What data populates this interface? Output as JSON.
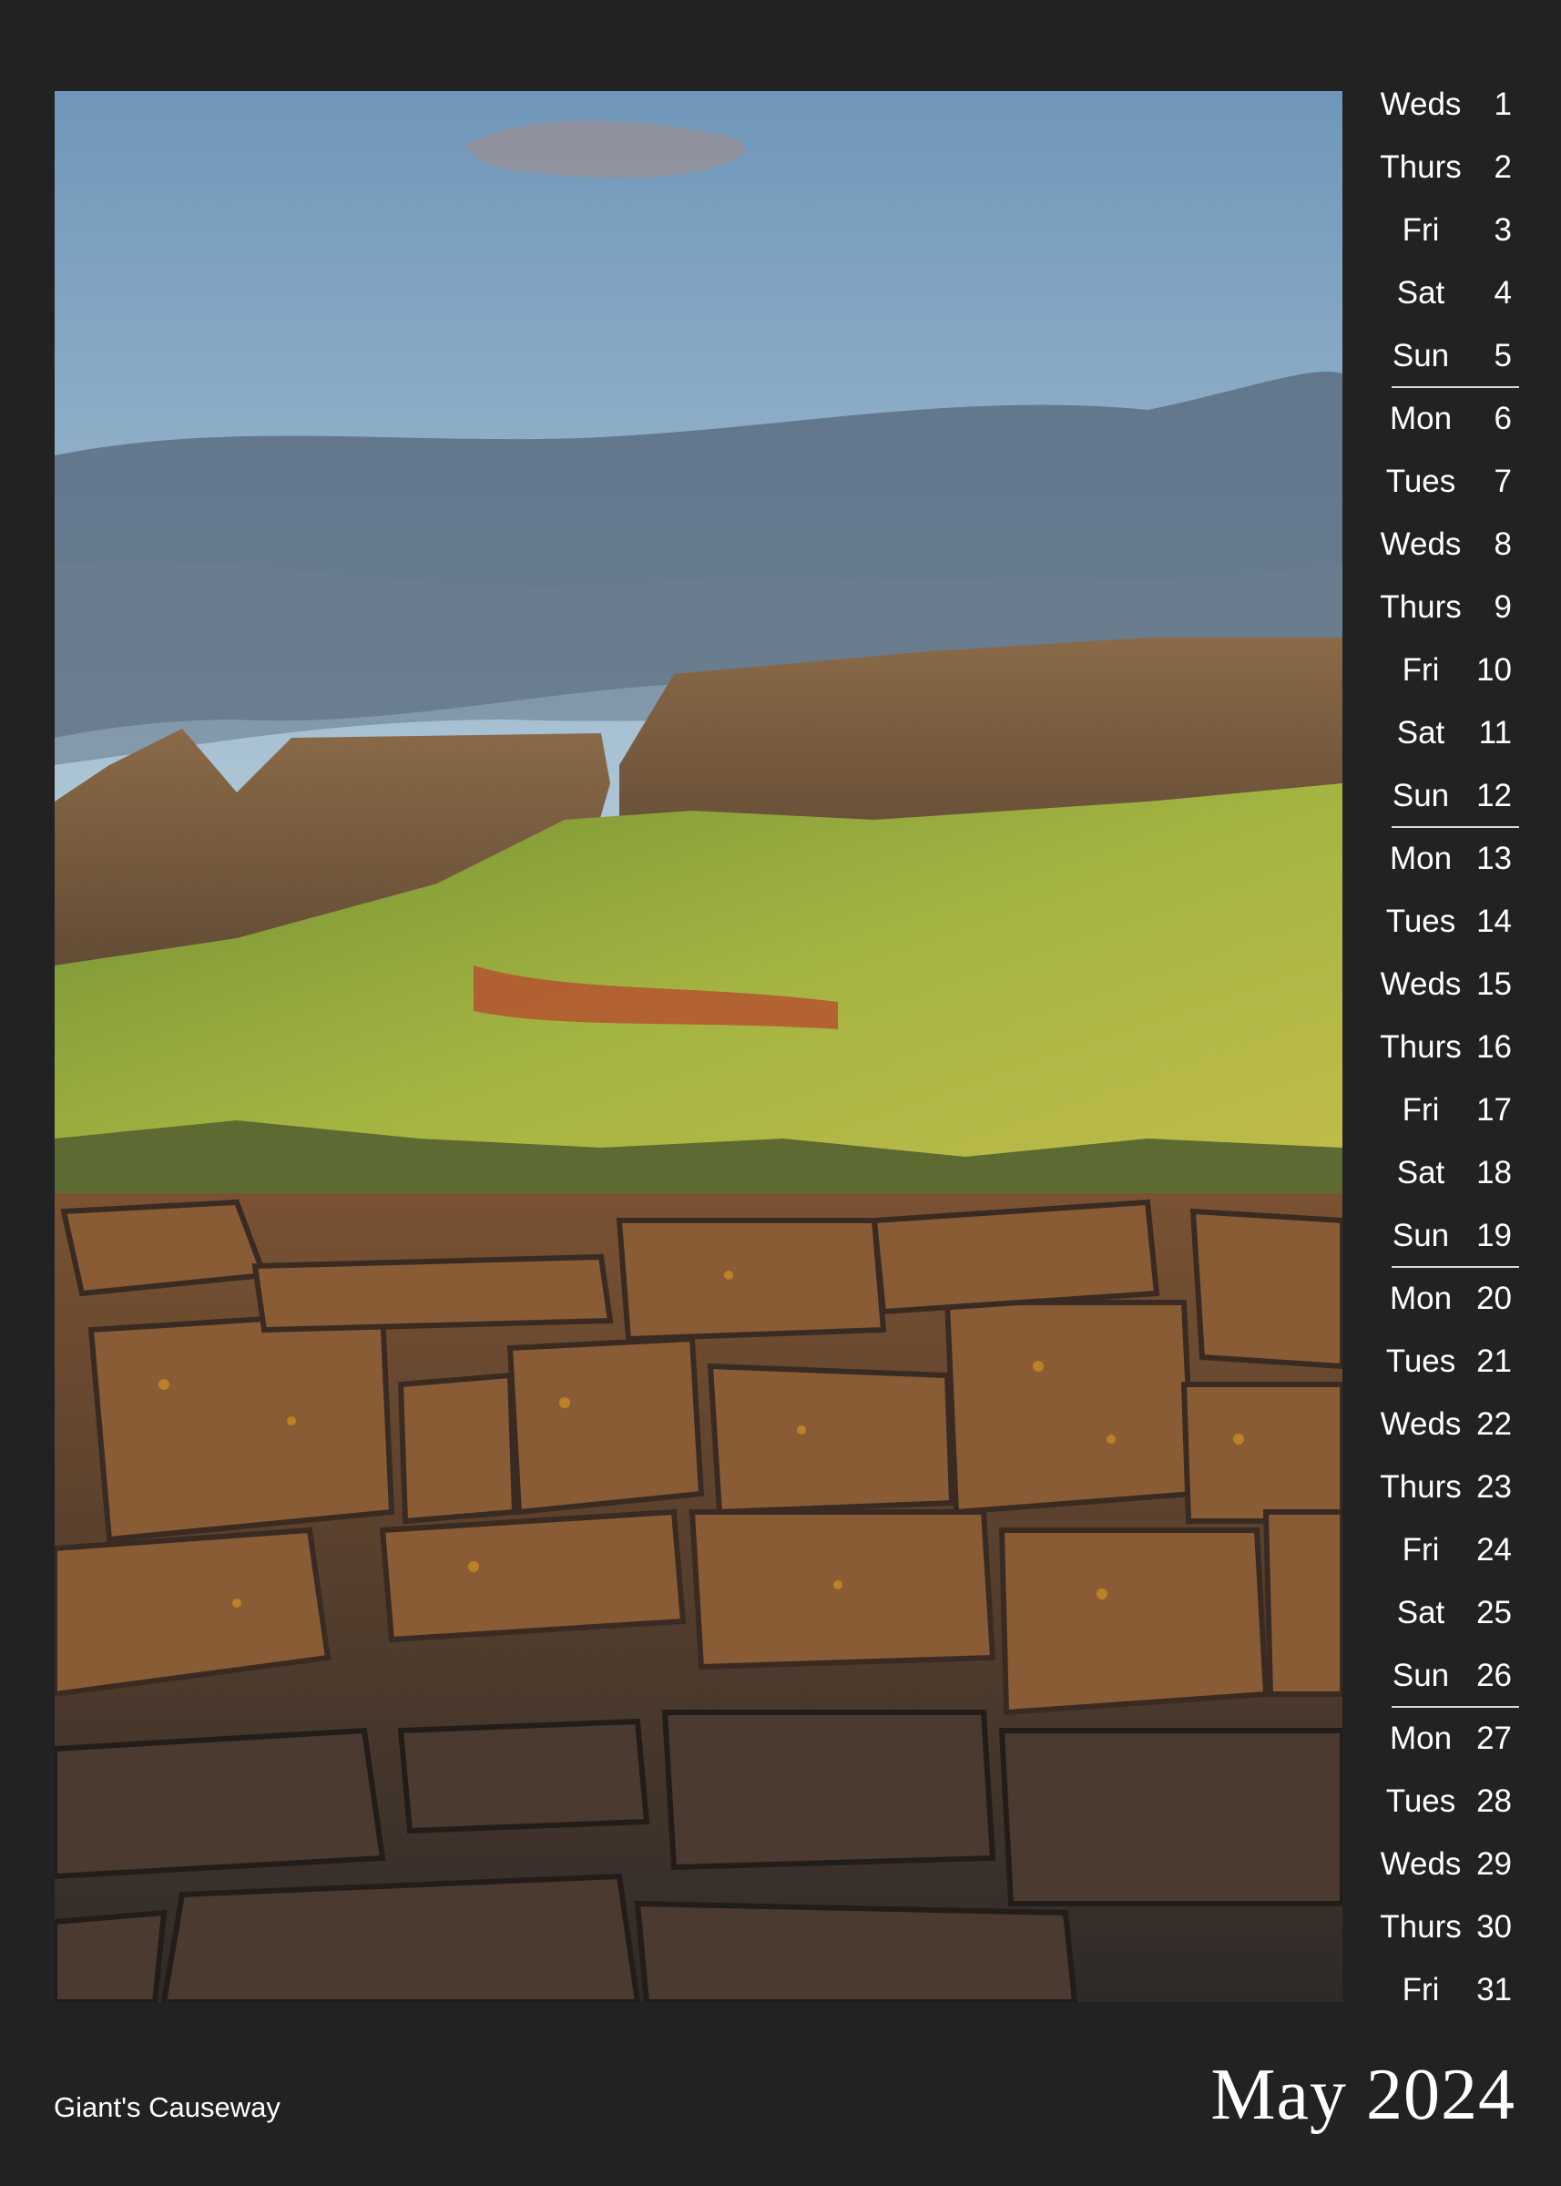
{
  "month_title": "May 2024",
  "caption": "Giant's Causeway",
  "photo": {
    "subject": "basalt-columns-cliffs-photo",
    "colors": {
      "sky_top": "#7fa3c2",
      "sky_bottom": "#c3d5df",
      "cloud": "#4d5d6d",
      "cliff": "#6b5138",
      "grass": "#8aa33c",
      "rock": "#6e4a2e",
      "lichen": "#c98b1f"
    }
  },
  "days": [
    {
      "name": "Weds",
      "date": "1"
    },
    {
      "name": "Thurs",
      "date": "2"
    },
    {
      "name": "Fri",
      "date": "3"
    },
    {
      "name": "Sat",
      "date": "4"
    },
    {
      "name": "Sun",
      "date": "5",
      "week_end": true
    },
    {
      "name": "Mon",
      "date": "6"
    },
    {
      "name": "Tues",
      "date": "7"
    },
    {
      "name": "Weds",
      "date": "8"
    },
    {
      "name": "Thurs",
      "date": "9"
    },
    {
      "name": "Fri",
      "date": "10"
    },
    {
      "name": "Sat",
      "date": "11"
    },
    {
      "name": "Sun",
      "date": "12",
      "week_end": true
    },
    {
      "name": "Mon",
      "date": "13"
    },
    {
      "name": "Tues",
      "date": "14"
    },
    {
      "name": "Weds",
      "date": "15"
    },
    {
      "name": "Thurs",
      "date": "16"
    },
    {
      "name": "Fri",
      "date": "17"
    },
    {
      "name": "Sat",
      "date": "18"
    },
    {
      "name": "Sun",
      "date": "19",
      "week_end": true
    },
    {
      "name": "Mon",
      "date": "20"
    },
    {
      "name": "Tues",
      "date": "21"
    },
    {
      "name": "Weds",
      "date": "22"
    },
    {
      "name": "Thurs",
      "date": "23"
    },
    {
      "name": "Fri",
      "date": "24"
    },
    {
      "name": "Sat",
      "date": "25"
    },
    {
      "name": "Sun",
      "date": "26",
      "week_end": true
    },
    {
      "name": "Mon",
      "date": "27"
    },
    {
      "name": "Tues",
      "date": "28"
    },
    {
      "name": "Weds",
      "date": "29"
    },
    {
      "name": "Thurs",
      "date": "30"
    },
    {
      "name": "Fri",
      "date": "31"
    }
  ]
}
